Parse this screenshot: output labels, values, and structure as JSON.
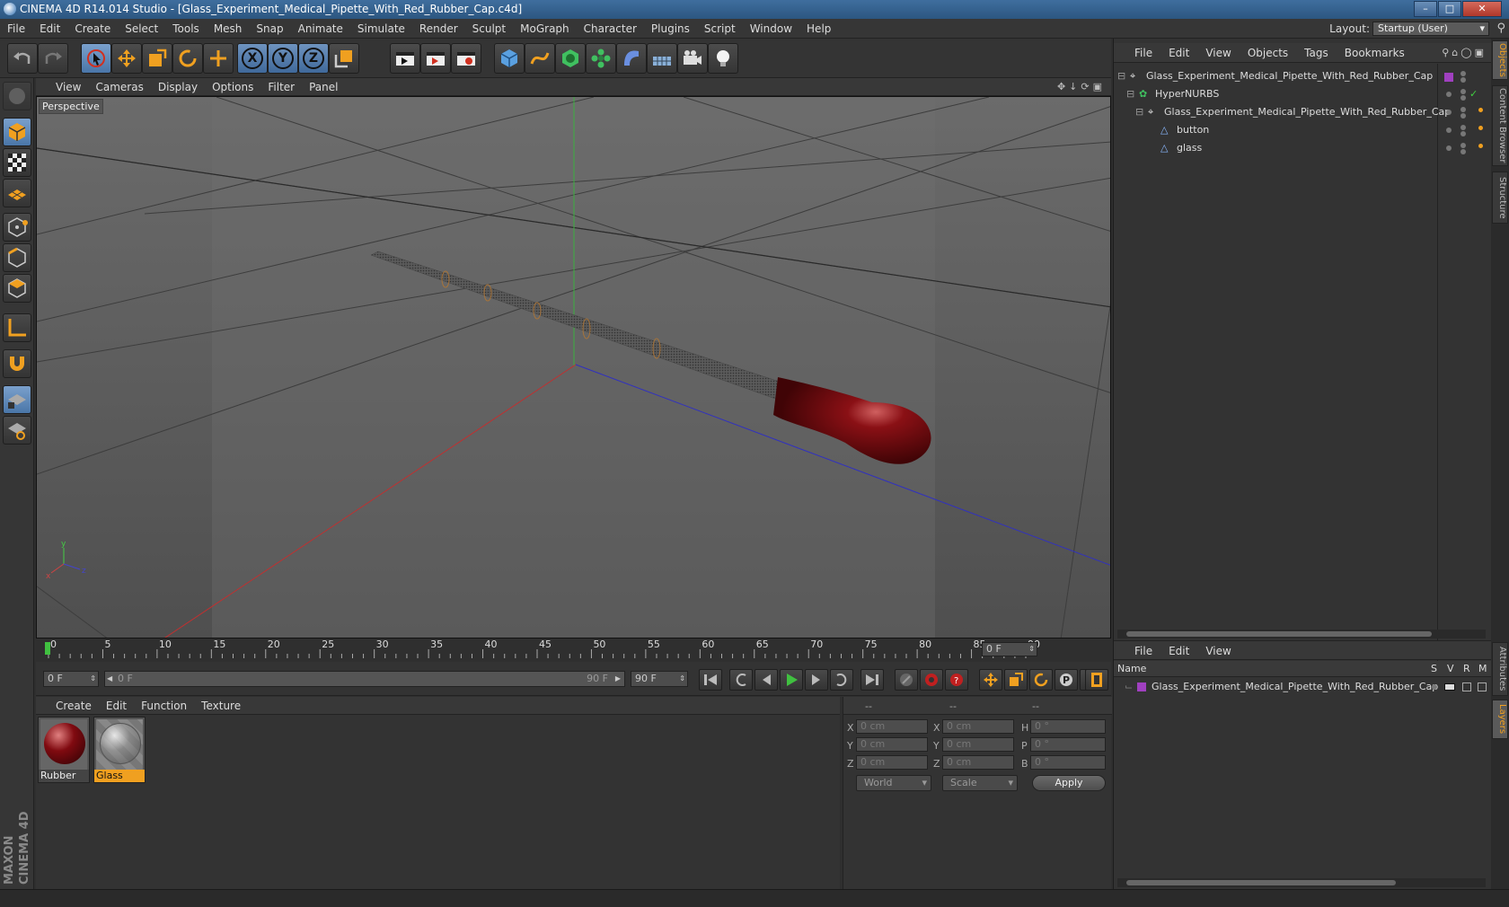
{
  "window": {
    "title": "CINEMA 4D R14.014 Studio - [Glass_Experiment_Medical_Pipette_With_Red_Rubber_Cap.c4d]"
  },
  "menubar": {
    "items": [
      "File",
      "Edit",
      "Create",
      "Select",
      "Tools",
      "Mesh",
      "Snap",
      "Animate",
      "Simulate",
      "Render",
      "Sculpt",
      "MoGraph",
      "Character",
      "Plugins",
      "Script",
      "Window",
      "Help"
    ],
    "layout_label": "Layout:",
    "layout_value": "Startup (User)"
  },
  "toolbar": {
    "axis_x": "X",
    "axis_y": "Y",
    "axis_z": "Z",
    "icons": [
      "undo-icon",
      "redo-icon",
      "live-select-icon",
      "move-icon",
      "scale-icon",
      "rotate-icon",
      "add-icon",
      "x-axis-icon",
      "y-axis-icon",
      "z-axis-icon",
      "coordinate-system-icon",
      "render-view-icon",
      "render-picture-viewer-icon",
      "edit-render-settings-icon",
      "cube-icon",
      "spline-icon",
      "nurbs-icon",
      "array-icon",
      "deformer-icon",
      "scene-floor-icon",
      "camera-icon",
      "light-icon"
    ]
  },
  "viewport": {
    "menu": [
      "View",
      "Cameras",
      "Display",
      "Options",
      "Filter",
      "Panel"
    ],
    "label": "Perspective",
    "axis_x": "x",
    "axis_y": "y",
    "axis_z": "z"
  },
  "timeline": {
    "ticks": [
      "0",
      "5",
      "10",
      "15",
      "20",
      "25",
      "30",
      "35",
      "40",
      "45",
      "50",
      "55",
      "60",
      "65",
      "70",
      "75",
      "80",
      "85",
      "90"
    ],
    "current_frame": "0 F"
  },
  "transport": {
    "start_field": "0 F",
    "range_start": "0 F",
    "range_end": "90 F",
    "end_field": "90 F"
  },
  "materials": {
    "menu": [
      "Create",
      "Edit",
      "Function",
      "Texture"
    ],
    "items": [
      {
        "name": "Rubber",
        "selected": false
      },
      {
        "name": "Glass",
        "selected": true
      }
    ]
  },
  "coordinates": {
    "header_pos": "--",
    "header_size": "--",
    "header_rot": "--",
    "x_label": "X",
    "y_label": "Y",
    "z_label": "Z",
    "x_pos": "0 cm",
    "y_pos": "0 cm",
    "z_pos": "0 cm",
    "sx_label": "X",
    "sy_label": "Y",
    "sz_label": "Z",
    "x_size": "0 cm",
    "y_size": "0 cm",
    "z_size": "0 cm",
    "h_label": "H",
    "p_label": "P",
    "b_label": "B",
    "h_rot": "0 °",
    "p_rot": "0 °",
    "b_rot": "0 °",
    "space": "World",
    "mode": "Scale",
    "apply": "Apply"
  },
  "objects": {
    "menu": [
      "File",
      "Edit",
      "View",
      "Objects",
      "Tags",
      "Bookmarks"
    ],
    "tree": [
      {
        "name": "Glass_Experiment_Medical_Pipette_With_Red_Rubber_Cap",
        "level": 0,
        "icon": "null-object-icon"
      },
      {
        "name": "HyperNURBS",
        "level": 1,
        "icon": "hypernurbs-icon"
      },
      {
        "name": "Glass_Experiment_Medical_Pipette_With_Red_Rubber_Cap",
        "level": 2,
        "icon": "null-object-icon"
      },
      {
        "name": "button",
        "level": 3,
        "icon": "polygon-object-icon"
      },
      {
        "name": "glass",
        "level": 3,
        "icon": "polygon-object-icon"
      }
    ]
  },
  "layers": {
    "menu": [
      "File",
      "Edit",
      "View"
    ],
    "header_name": "Name",
    "header_s": "S",
    "header_v": "V",
    "header_r": "R",
    "header_m": "M",
    "row": "Glass_Experiment_Medical_Pipette_With_Red_Rubber_Cap"
  },
  "sidetabs": [
    "Objects",
    "Content Browser",
    "Structure",
    "Attributes",
    "Layers"
  ],
  "colors": {
    "accent": "#f0a020",
    "selection": "#5a86b8",
    "rubber": "#7a0a0e",
    "layer": "#a040c0"
  }
}
